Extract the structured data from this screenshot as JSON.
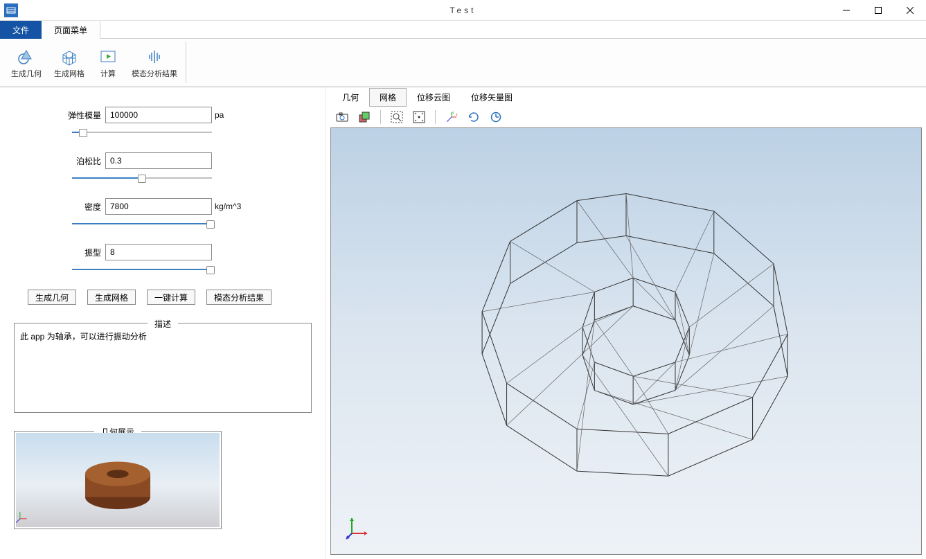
{
  "window": {
    "title": "Test"
  },
  "menu": {
    "file": "文件",
    "page_menu": "页面菜单"
  },
  "ribbon": {
    "gen_geometry": "生成几何",
    "gen_mesh": "生成网格",
    "compute": "计算",
    "modal_results": "模态分析结果"
  },
  "params": {
    "elastic_modulus": {
      "label": "弹性模量",
      "value": "100000",
      "unit": "pa",
      "slider_pct": 8
    },
    "poisson_ratio": {
      "label": "泊松比",
      "value": "0.3",
      "unit": "",
      "slider_pct": 50
    },
    "density": {
      "label": "密度",
      "value": "7800",
      "unit": "kg/m^3",
      "slider_pct": 99
    },
    "mode_shape": {
      "label": "振型",
      "value": "8",
      "unit": "",
      "slider_pct": 99
    }
  },
  "buttons": {
    "gen_geometry": "生成几何",
    "gen_mesh": "生成网格",
    "one_click_compute": "一键计算",
    "modal_results": "模态分析结果"
  },
  "description": {
    "legend": "描述",
    "text": "此 app 为轴承，可以进行振动分析"
  },
  "geometry_preview": {
    "legend": "几何展示"
  },
  "view_tabs": {
    "geometry": "几何",
    "mesh": "网格",
    "disp_contour": "位移云图",
    "disp_vector": "位移矢量图"
  }
}
